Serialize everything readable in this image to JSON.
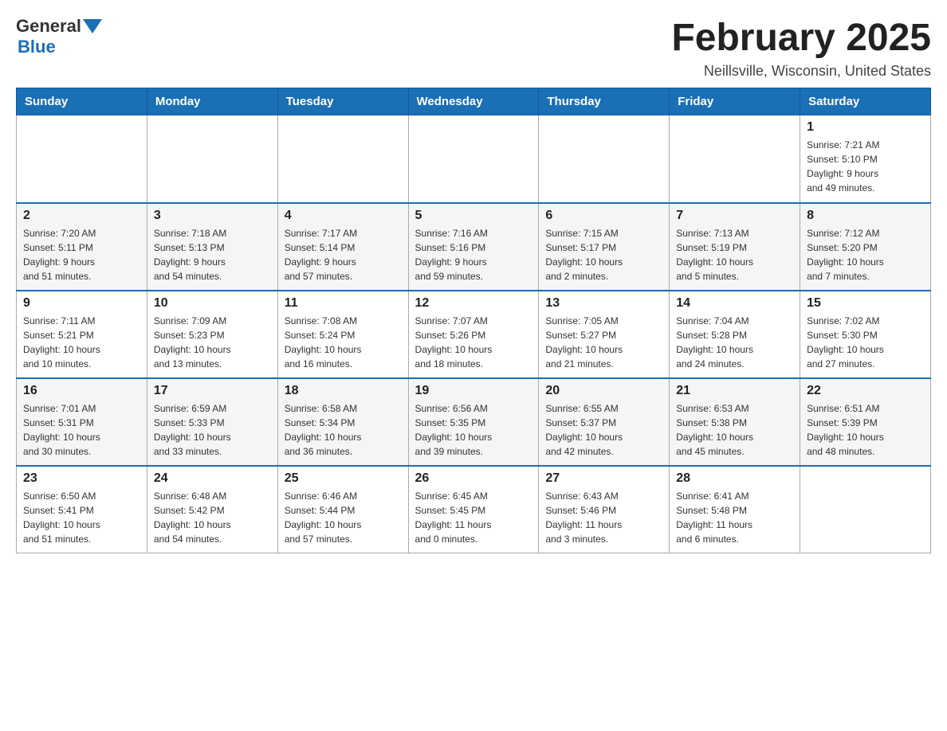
{
  "logo": {
    "general": "General",
    "blue": "Blue"
  },
  "title": "February 2025",
  "location": "Neillsville, Wisconsin, United States",
  "days_of_week": [
    "Sunday",
    "Monday",
    "Tuesday",
    "Wednesday",
    "Thursday",
    "Friday",
    "Saturday"
  ],
  "weeks": [
    [
      {
        "day": "",
        "info": ""
      },
      {
        "day": "",
        "info": ""
      },
      {
        "day": "",
        "info": ""
      },
      {
        "day": "",
        "info": ""
      },
      {
        "day": "",
        "info": ""
      },
      {
        "day": "",
        "info": ""
      },
      {
        "day": "1",
        "info": "Sunrise: 7:21 AM\nSunset: 5:10 PM\nDaylight: 9 hours\nand 49 minutes."
      }
    ],
    [
      {
        "day": "2",
        "info": "Sunrise: 7:20 AM\nSunset: 5:11 PM\nDaylight: 9 hours\nand 51 minutes."
      },
      {
        "day": "3",
        "info": "Sunrise: 7:18 AM\nSunset: 5:13 PM\nDaylight: 9 hours\nand 54 minutes."
      },
      {
        "day": "4",
        "info": "Sunrise: 7:17 AM\nSunset: 5:14 PM\nDaylight: 9 hours\nand 57 minutes."
      },
      {
        "day": "5",
        "info": "Sunrise: 7:16 AM\nSunset: 5:16 PM\nDaylight: 9 hours\nand 59 minutes."
      },
      {
        "day": "6",
        "info": "Sunrise: 7:15 AM\nSunset: 5:17 PM\nDaylight: 10 hours\nand 2 minutes."
      },
      {
        "day": "7",
        "info": "Sunrise: 7:13 AM\nSunset: 5:19 PM\nDaylight: 10 hours\nand 5 minutes."
      },
      {
        "day": "8",
        "info": "Sunrise: 7:12 AM\nSunset: 5:20 PM\nDaylight: 10 hours\nand 7 minutes."
      }
    ],
    [
      {
        "day": "9",
        "info": "Sunrise: 7:11 AM\nSunset: 5:21 PM\nDaylight: 10 hours\nand 10 minutes."
      },
      {
        "day": "10",
        "info": "Sunrise: 7:09 AM\nSunset: 5:23 PM\nDaylight: 10 hours\nand 13 minutes."
      },
      {
        "day": "11",
        "info": "Sunrise: 7:08 AM\nSunset: 5:24 PM\nDaylight: 10 hours\nand 16 minutes."
      },
      {
        "day": "12",
        "info": "Sunrise: 7:07 AM\nSunset: 5:26 PM\nDaylight: 10 hours\nand 18 minutes."
      },
      {
        "day": "13",
        "info": "Sunrise: 7:05 AM\nSunset: 5:27 PM\nDaylight: 10 hours\nand 21 minutes."
      },
      {
        "day": "14",
        "info": "Sunrise: 7:04 AM\nSunset: 5:28 PM\nDaylight: 10 hours\nand 24 minutes."
      },
      {
        "day": "15",
        "info": "Sunrise: 7:02 AM\nSunset: 5:30 PM\nDaylight: 10 hours\nand 27 minutes."
      }
    ],
    [
      {
        "day": "16",
        "info": "Sunrise: 7:01 AM\nSunset: 5:31 PM\nDaylight: 10 hours\nand 30 minutes."
      },
      {
        "day": "17",
        "info": "Sunrise: 6:59 AM\nSunset: 5:33 PM\nDaylight: 10 hours\nand 33 minutes."
      },
      {
        "day": "18",
        "info": "Sunrise: 6:58 AM\nSunset: 5:34 PM\nDaylight: 10 hours\nand 36 minutes."
      },
      {
        "day": "19",
        "info": "Sunrise: 6:56 AM\nSunset: 5:35 PM\nDaylight: 10 hours\nand 39 minutes."
      },
      {
        "day": "20",
        "info": "Sunrise: 6:55 AM\nSunset: 5:37 PM\nDaylight: 10 hours\nand 42 minutes."
      },
      {
        "day": "21",
        "info": "Sunrise: 6:53 AM\nSunset: 5:38 PM\nDaylight: 10 hours\nand 45 minutes."
      },
      {
        "day": "22",
        "info": "Sunrise: 6:51 AM\nSunset: 5:39 PM\nDaylight: 10 hours\nand 48 minutes."
      }
    ],
    [
      {
        "day": "23",
        "info": "Sunrise: 6:50 AM\nSunset: 5:41 PM\nDaylight: 10 hours\nand 51 minutes."
      },
      {
        "day": "24",
        "info": "Sunrise: 6:48 AM\nSunset: 5:42 PM\nDaylight: 10 hours\nand 54 minutes."
      },
      {
        "day": "25",
        "info": "Sunrise: 6:46 AM\nSunset: 5:44 PM\nDaylight: 10 hours\nand 57 minutes."
      },
      {
        "day": "26",
        "info": "Sunrise: 6:45 AM\nSunset: 5:45 PM\nDaylight: 11 hours\nand 0 minutes."
      },
      {
        "day": "27",
        "info": "Sunrise: 6:43 AM\nSunset: 5:46 PM\nDaylight: 11 hours\nand 3 minutes."
      },
      {
        "day": "28",
        "info": "Sunrise: 6:41 AM\nSunset: 5:48 PM\nDaylight: 11 hours\nand 6 minutes."
      },
      {
        "day": "",
        "info": ""
      }
    ]
  ]
}
